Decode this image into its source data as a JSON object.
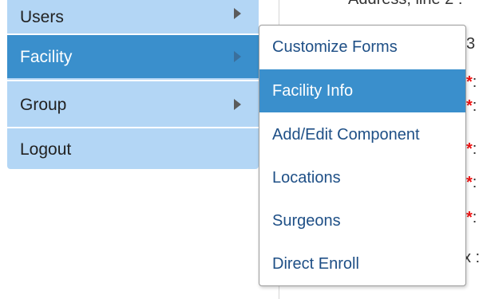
{
  "background": {
    "address_label": "Address, line 2 :",
    "row_texts": [
      "3 :",
      ":",
      ":",
      ":",
      ":",
      ":",
      "x :"
    ]
  },
  "left_menu": {
    "items": [
      {
        "label": "Users",
        "has_submenu": true
      },
      {
        "label": "Facility",
        "has_submenu": true,
        "active": true
      },
      {
        "label": "Group",
        "has_submenu": true
      },
      {
        "label": "Logout",
        "has_submenu": false
      }
    ]
  },
  "submenu": {
    "items": [
      {
        "label": "Customize Forms"
      },
      {
        "label": "Facility Info",
        "active": true
      },
      {
        "label": "Add/Edit Component"
      },
      {
        "label": "Locations"
      },
      {
        "label": "Surgeons"
      },
      {
        "label": "Direct Enroll"
      }
    ]
  },
  "colors": {
    "menu_bg": "#b3d6f5",
    "active_bg": "#3a8fcc",
    "submenu_text": "#1e4f86",
    "required_star": "#ee1111"
  }
}
